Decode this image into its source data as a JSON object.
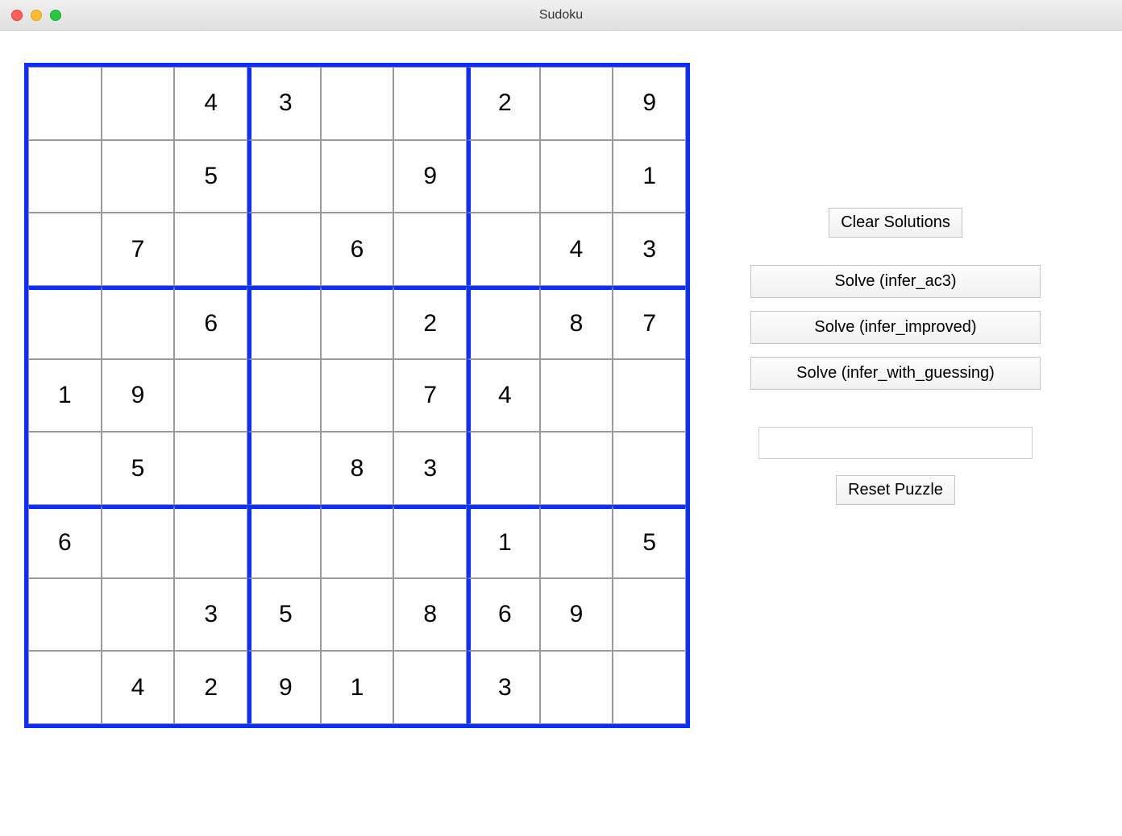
{
  "window": {
    "title": "Sudoku"
  },
  "sudoku": {
    "grid": [
      [
        "",
        "",
        "4",
        "3",
        "",
        "",
        "2",
        "",
        "9"
      ],
      [
        "",
        "",
        "5",
        "",
        "",
        "9",
        "",
        "",
        "1"
      ],
      [
        "",
        "7",
        "",
        "",
        "6",
        "",
        "",
        "4",
        "3"
      ],
      [
        "",
        "",
        "6",
        "",
        "",
        "2",
        "",
        "8",
        "7"
      ],
      [
        "1",
        "9",
        "",
        "",
        "",
        "7",
        "4",
        "",
        ""
      ],
      [
        "",
        "5",
        "",
        "",
        "8",
        "3",
        "",
        "",
        ""
      ],
      [
        "6",
        "",
        "",
        "",
        "",
        "",
        "1",
        "",
        "5"
      ],
      [
        "",
        "",
        "3",
        "5",
        "",
        "8",
        "6",
        "9",
        ""
      ],
      [
        "",
        "4",
        "2",
        "9",
        "1",
        "",
        "3",
        "",
        ""
      ]
    ]
  },
  "buttons": {
    "clear": "Clear Solutions",
    "solve1": "Solve (infer_ac3)",
    "solve2": "Solve (infer_improved)",
    "solve3": "Solve (infer_with_guessing)",
    "reset": "Reset Puzzle"
  },
  "input": {
    "value": ""
  }
}
